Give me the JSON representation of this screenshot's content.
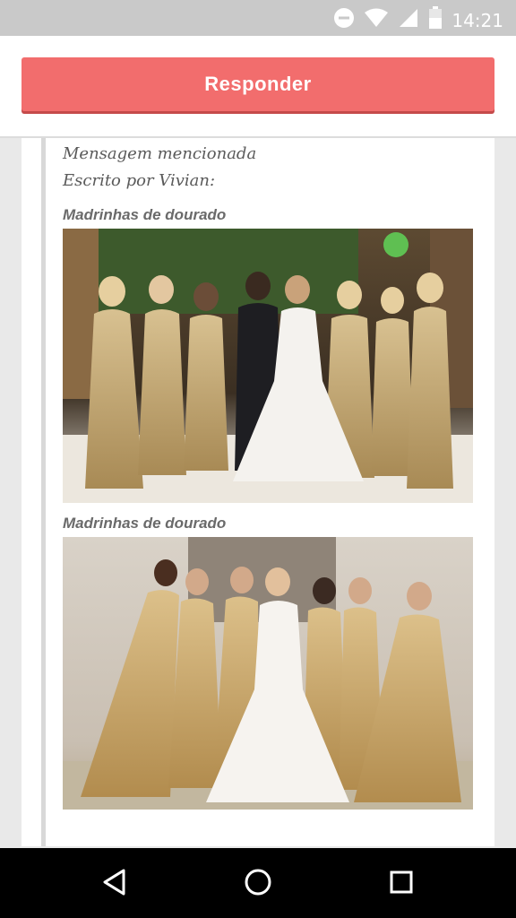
{
  "status_bar": {
    "time": "14:21",
    "icons": [
      "do-not-disturb-icon",
      "wifi-icon",
      "signal-icon",
      "battery-icon"
    ]
  },
  "reply_button": {
    "label": "Responder"
  },
  "quote": {
    "mention_label": "Mensagem mencionada",
    "author_line": "Escrito por Vivian:",
    "items": [
      {
        "caption": "Madrinhas de dourado",
        "image_icon": "wedding-photo-bridesmaids-gold"
      },
      {
        "caption": "Madrinhas de dourado",
        "image_icon": "wedding-photo-bridesmaids-gold"
      }
    ]
  },
  "nav_bar": {
    "icons": [
      "back-icon",
      "home-icon",
      "recents-icon"
    ]
  },
  "colors": {
    "accent": "#f26d6d",
    "status_bar": "#c9c9c9",
    "nav_bar": "#000000"
  }
}
